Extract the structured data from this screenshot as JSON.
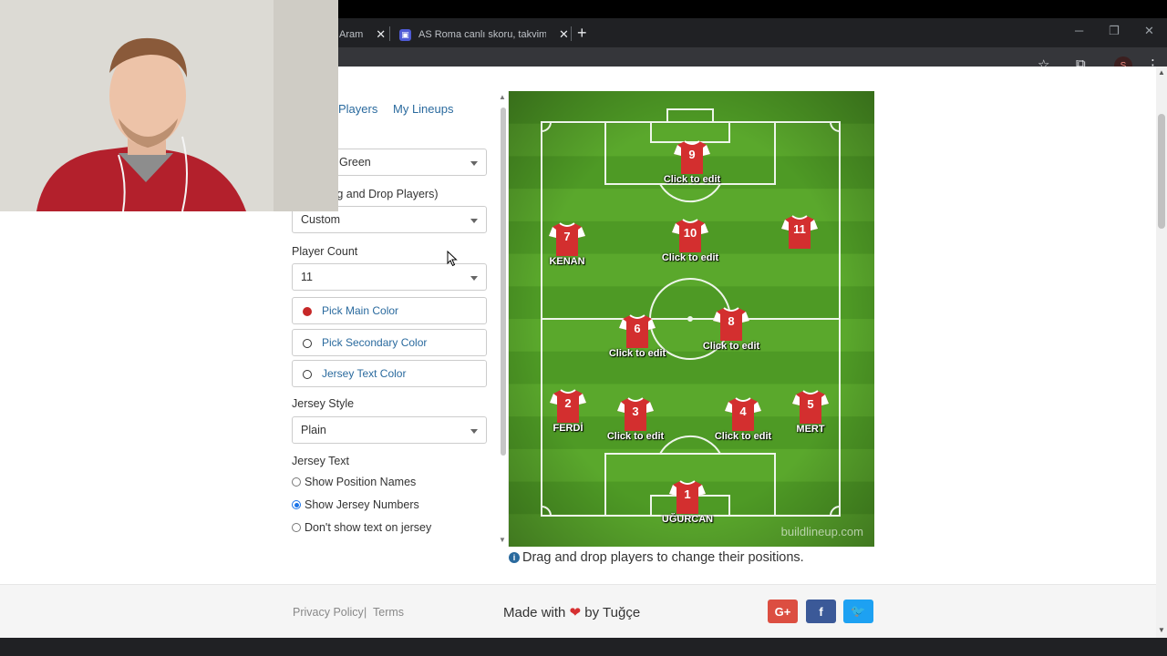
{
  "browser": {
    "tabs": [
      {
        "label": "Aram",
        "close": "✕"
      },
      {
        "label": "AS Roma canlı skoru, takvimi ve",
        "close": "✕"
      }
    ],
    "new_tab": "+",
    "window_controls": {
      "minimize": "─",
      "restore": "❐",
      "close": "✕"
    },
    "profile_initial": "S"
  },
  "panel": {
    "tabs": [
      "Players",
      "My Lineups"
    ],
    "field_color": {
      "value": "Green"
    },
    "formation": {
      "label": "n (or Drag and Drop Players)",
      "value": "Custom"
    },
    "player_count": {
      "label": "Player Count",
      "value": "11"
    },
    "color_buttons": [
      {
        "label": "Pick Main Color",
        "color": "#c62828",
        "icon": "filled-dot-icon"
      },
      {
        "label": "Pick Secondary Color",
        "color": "#ffffff",
        "icon": "empty-dot-icon"
      },
      {
        "label": "Jersey Text Color",
        "color": "#ffffff",
        "icon": "empty-dot-icon"
      }
    ],
    "jersey_style": {
      "label": "Jersey Style",
      "value": "Plain"
    },
    "jersey_text": {
      "label": "Jersey Text",
      "options": [
        {
          "label": "Show Position Names",
          "selected": false
        },
        {
          "label": "Show Jersey Numbers",
          "selected": true
        },
        {
          "label": "Don't show text on jersey",
          "selected": false
        }
      ]
    }
  },
  "field": {
    "players": [
      {
        "number": "9",
        "name": "Click to edit"
      },
      {
        "number": "7",
        "name": "KENAN"
      },
      {
        "number": "10",
        "name": "Click to edit"
      },
      {
        "number": "11",
        "name": ""
      },
      {
        "number": "6",
        "name": "Click to edit"
      },
      {
        "number": "8",
        "name": "Click to edit"
      },
      {
        "number": "2",
        "name": "FERDİ"
      },
      {
        "number": "3",
        "name": "Click to edit"
      },
      {
        "number": "4",
        "name": "Click to edit"
      },
      {
        "number": "5",
        "name": "MERT"
      },
      {
        "number": "1",
        "name": "UĞURCAN"
      }
    ],
    "watermark": "buildlineup.com",
    "jersey_color": "#d32f2f",
    "grass_colors": [
      "#4e9a25",
      "#5aa82c"
    ]
  },
  "hint": {
    "text": "Drag and drop players to change their positions."
  },
  "footer": {
    "privacy": "Privacy Policy",
    "separator": "|",
    "terms": "Terms",
    "made_with": "Made with",
    "by": "by Tuğçe",
    "social": [
      {
        "label": "G+",
        "color": "#dc4e41",
        "icon": "google-plus-icon"
      },
      {
        "label": "f",
        "color": "#3b5998",
        "icon": "facebook-icon"
      },
      {
        "label": "🐦",
        "color": "#1da1f2",
        "icon": "twitter-icon"
      }
    ]
  }
}
